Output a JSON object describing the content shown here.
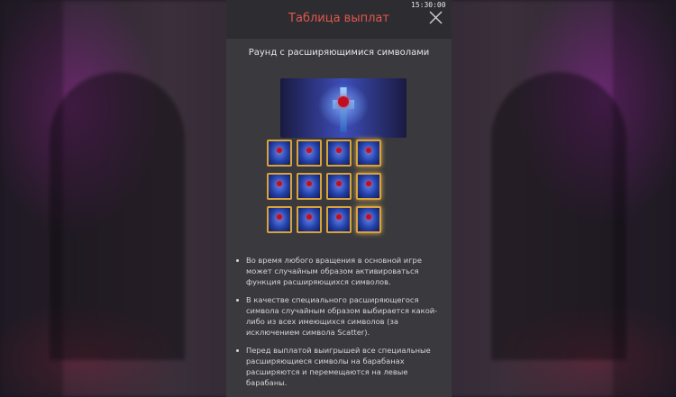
{
  "status_bar": {
    "time": "15:30:00"
  },
  "panel": {
    "title": "Таблица выплат",
    "close_icon": "close-icon",
    "section_title": "Раунд с расширяющимися символами",
    "rules": [
      "Во время любого вращения в основной игре может случайным образом активироваться функция расширяющихся символов.",
      "В качестве специального расширяющегося символа случайным образом выбирается какой-либо из всех имеющихся символов (за исключением символа Scatter).",
      "Перед выплатой выигрышей все специальные расширяющиеся символы на барабанах расширяются и перемещаются на левые барабаны."
    ]
  },
  "colors": {
    "title_accent": "#e2564e",
    "panel_bg": "#3a3a3e",
    "header_bg": "#2d2d31",
    "symbol_border": "#d9a23a"
  }
}
